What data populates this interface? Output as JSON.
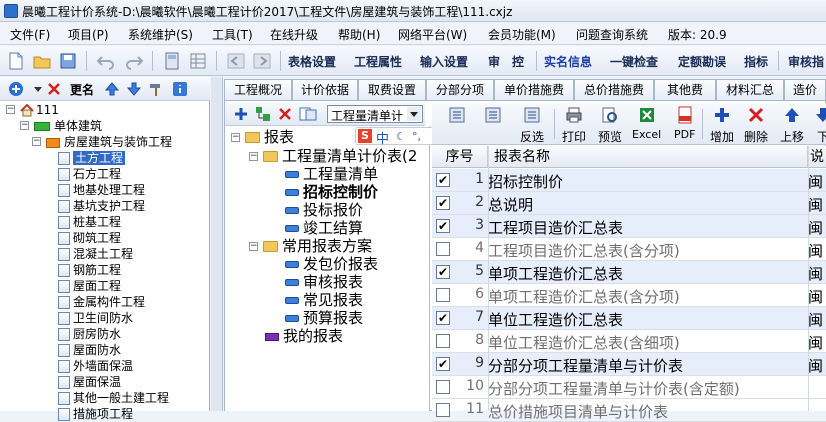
{
  "window": {
    "title": "晨曦工程计价系统-D:\\晨曦软件\\晨曦工程计价2017\\工程文件\\房屋建筑与装饰工程\\111.cxjz"
  },
  "menu": [
    "文件(F)",
    "项目(P)",
    "系统维护(S)",
    "工具(T)",
    "在线升级",
    "帮助(H)",
    "网络平台(W)",
    "会员功能(M)",
    "问题查询系统",
    "版本: 20.9"
  ],
  "toolbar": {
    "text_buttons": [
      "表格设置",
      "工程属性",
      "输入设置",
      "审",
      "控"
    ],
    "blue_buttons": [
      "实名信息",
      "一键检查",
      "定额勘误",
      "指标",
      "审核指"
    ]
  },
  "left_panel": {
    "rename_label": "更名",
    "tree": {
      "root": "111",
      "level1": "单体建筑",
      "level2": "房屋建筑与装饰工程",
      "items": [
        "土方工程",
        "石方工程",
        "地基处理工程",
        "基坑支护工程",
        "桩基工程",
        "砌筑工程",
        "混凝土工程",
        "钢筋工程",
        "屋面工程",
        "金属构件工程",
        "卫生间防水",
        "厨房防水",
        "屋面防水",
        "外墙面保温",
        "屋面保温",
        "其他一般土建工程",
        "措施项工程"
      ],
      "selected_index": 0
    }
  },
  "tabs": [
    "工程概况",
    "计价依据",
    "取费设置",
    "分部分项",
    "单价措施费",
    "总价措施费",
    "其他费",
    "材料汇总",
    "造价"
  ],
  "report_panel": {
    "dropdown_value": "工程量清单计",
    "tree": {
      "root": "报表",
      "group1": "工程量清单计价表(2",
      "group1_items": [
        "工程量清单",
        "招标控制价",
        "投标报价",
        "竣工结算"
      ],
      "selected": "招标控制价",
      "group2": "常用报表方案",
      "group2_items": [
        "发包价报表",
        "审核报表",
        "常见报表",
        "预算报表"
      ],
      "mine": "我的报表"
    },
    "ime": {
      "label": "中"
    }
  },
  "report_toolbar": {
    "buttons": [
      "反选",
      "打印",
      "预览",
      "Excel",
      "PDF",
      "增加",
      "删除",
      "上移",
      "下"
    ]
  },
  "report_table": {
    "columns": [
      "序号",
      "报表名称",
      "说"
    ],
    "rows": [
      {
        "no": "1",
        "name": "招标控制价",
        "checked": true,
        "desc": "闽"
      },
      {
        "no": "2",
        "name": "总说明",
        "checked": true,
        "desc": "闽"
      },
      {
        "no": "3",
        "name": "工程项目造价汇总表",
        "checked": true,
        "desc": "闽"
      },
      {
        "no": "4",
        "name": "工程项目造价汇总表(含分项)",
        "checked": false,
        "desc": "闽"
      },
      {
        "no": "5",
        "name": "单项工程造价汇总表",
        "checked": true,
        "desc": "闽"
      },
      {
        "no": "6",
        "name": "单项工程造价汇总表(含分项)",
        "checked": false,
        "desc": "闽"
      },
      {
        "no": "7",
        "name": "单位工程造价汇总表",
        "checked": true,
        "desc": "闽"
      },
      {
        "no": "8",
        "name": "单位工程造价汇总表(含细项)",
        "checked": false,
        "desc": "闽"
      },
      {
        "no": "9",
        "name": "分部分项工程量清单与计价表",
        "checked": true,
        "desc": "闽"
      },
      {
        "no": "10",
        "name": "分部分项工程量清单与计价表(含定额)",
        "checked": false,
        "desc": ""
      },
      {
        "no": "11",
        "name": "总价措施项目清单与计价表",
        "checked": false,
        "desc": ""
      }
    ]
  },
  "colors": {
    "selection": "#316ac5",
    "accent": "#1c3fa8"
  }
}
